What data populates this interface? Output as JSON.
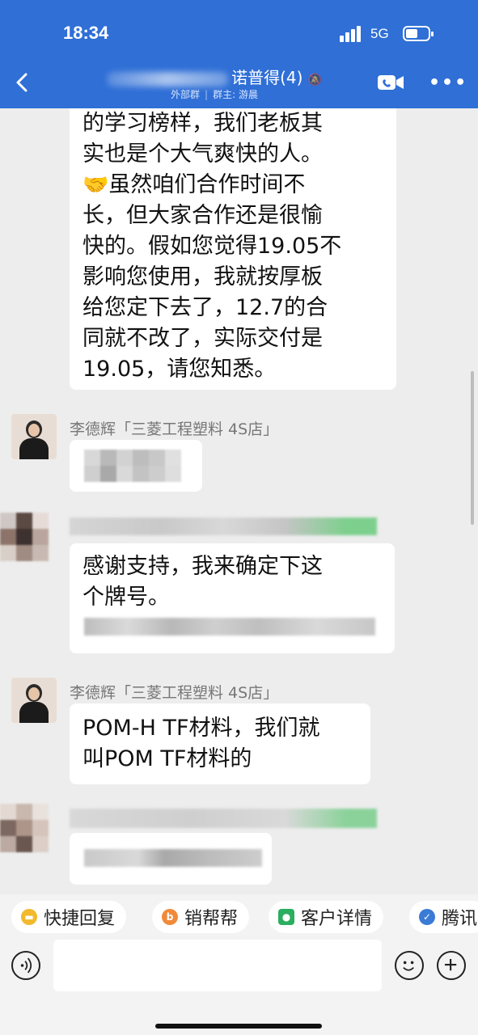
{
  "status_bar": {
    "time": "18:34",
    "network": "5G"
  },
  "header": {
    "title": "诺普得(4)",
    "tag": "外部群",
    "owner": "群主: 游晨",
    "colors": {
      "primary": "#2f6fd6"
    }
  },
  "messages": [
    {
      "type": "text",
      "lines": [
        "的学习榜样，我们老板其",
        "实也是个大气爽快的人。",
        "虽然咱们合作时间不",
        "长，但大家合作还是很愉",
        "快的。假如您觉得19.05不",
        "影响您使用，我就按厚板",
        "给您定下去了，12.7的合",
        "同就不改了，实际交付是",
        "19.05，请您知悉。"
      ],
      "emoji": "🤝"
    },
    {
      "type": "redacted",
      "sender": "李德辉「三菱工程塑料 4S店」"
    },
    {
      "type": "text",
      "lines": [
        "感谢支持，我来确定下这",
        "个牌号。"
      ]
    },
    {
      "type": "text",
      "sender": "李德辉「三菱工程塑料 4S店」",
      "lines": [
        "POM-H TF材料，我们就",
        "叫POM TF材料的"
      ]
    }
  ],
  "quick_actions": [
    {
      "label": "快捷回复",
      "icon": "chat-bubble-icon",
      "color": "#f2b92c"
    },
    {
      "label": "销帮帮",
      "icon": "b-logo-icon",
      "color": "#f08a3a"
    },
    {
      "label": "客户详情",
      "icon": "person-icon",
      "color": "#2aae5f"
    },
    {
      "label": "腾讯",
      "icon": "tencent-icon",
      "color": "#3a7bd5"
    }
  ]
}
